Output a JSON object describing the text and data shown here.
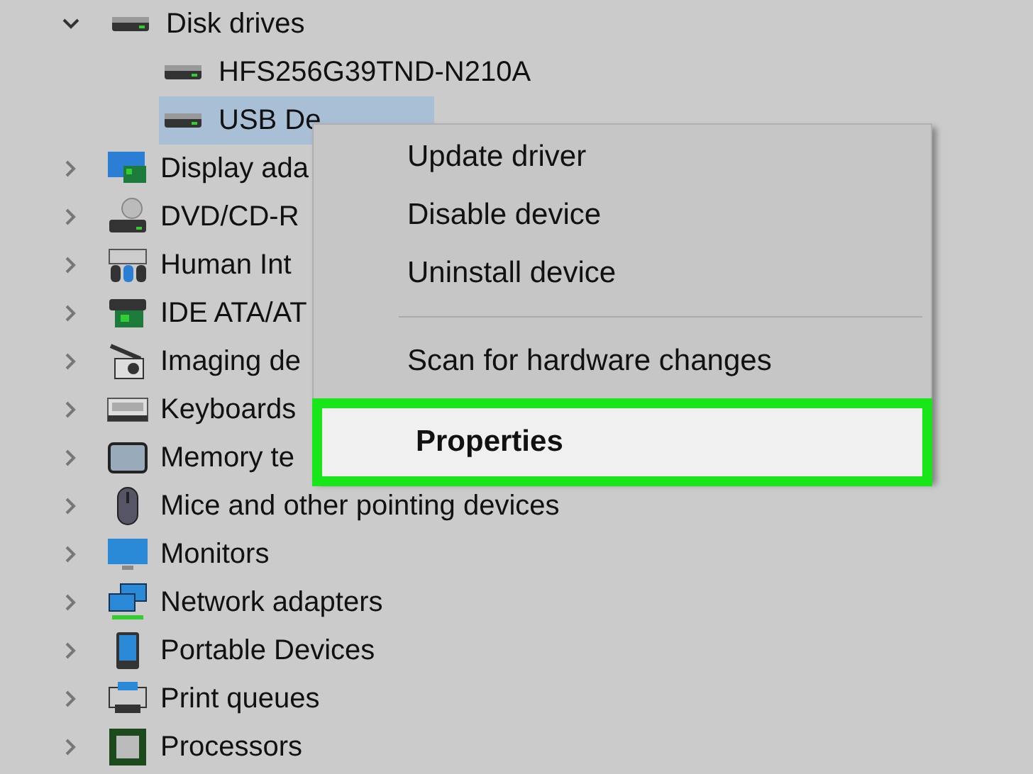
{
  "tree": [
    {
      "label": "Disk drives",
      "kind": "drive",
      "expanded": true,
      "selected": false,
      "children": [
        {
          "label": "HFS256G39TND-N210A",
          "kind": "drive",
          "selected": false
        },
        {
          "label": "USB De",
          "kind": "drive",
          "selected": true
        }
      ]
    },
    {
      "label": "Display ada",
      "kind": "display",
      "expanded": false,
      "selected": false
    },
    {
      "label": "DVD/CD-R",
      "kind": "dvd",
      "expanded": false,
      "selected": false
    },
    {
      "label": "Human Int",
      "kind": "hid",
      "expanded": false,
      "selected": false
    },
    {
      "label": "IDE ATA/AT",
      "kind": "ide",
      "expanded": false,
      "selected": false
    },
    {
      "label": "Imaging de",
      "kind": "camera",
      "expanded": false,
      "selected": false
    },
    {
      "label": "Keyboards",
      "kind": "keyboard",
      "expanded": false,
      "selected": false
    },
    {
      "label": "Memory te",
      "kind": "memory",
      "expanded": false,
      "selected": false
    },
    {
      "label": "Mice and other pointing devices",
      "kind": "mouse",
      "expanded": false,
      "selected": false
    },
    {
      "label": "Monitors",
      "kind": "monitor",
      "expanded": false,
      "selected": false
    },
    {
      "label": "Network adapters",
      "kind": "network",
      "expanded": false,
      "selected": false
    },
    {
      "label": "Portable Devices",
      "kind": "portable",
      "expanded": false,
      "selected": false
    },
    {
      "label": "Print queues",
      "kind": "printer",
      "expanded": false,
      "selected": false
    },
    {
      "label": "Processors",
      "kind": "cpu",
      "expanded": false,
      "selected": false
    }
  ],
  "context_menu": {
    "items": [
      {
        "label": "Update driver",
        "kind": "item",
        "selected": false
      },
      {
        "label": "Disable device",
        "kind": "item",
        "selected": false
      },
      {
        "label": "Uninstall device",
        "kind": "item",
        "selected": false
      },
      {
        "kind": "separator"
      },
      {
        "label": "Scan for hardware changes",
        "kind": "item",
        "selected": false
      },
      {
        "label": "Properties",
        "kind": "default",
        "selected": true
      }
    ]
  }
}
